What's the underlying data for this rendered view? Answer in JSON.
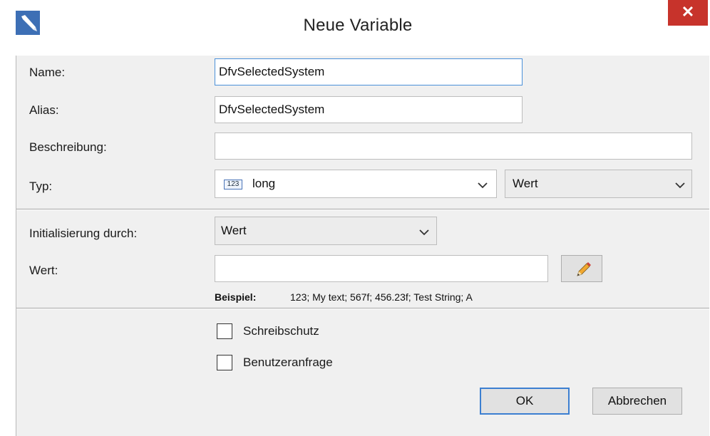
{
  "window": {
    "title": "Neue Variable",
    "close_glyph": "✕"
  },
  "form": {
    "name_label": "Name:",
    "name_value": "DfvSelectedSystem",
    "alias_label": "Alias:",
    "alias_value": "DfvSelectedSystem",
    "description_label": "Beschreibung:",
    "description_value": "",
    "type_label": "Typ:",
    "type_icon_text": "123",
    "type_value": "long",
    "type_mode_value": "Wert"
  },
  "init": {
    "label": "Initialisierung durch:",
    "value": "Wert",
    "wert_label": "Wert:",
    "wert_value": "",
    "example_label": "Beispiel:",
    "example_text": "123; My text; 567f; 456.23f; Test String; A"
  },
  "options": {
    "readonly_label": "Schreibschutz",
    "readonly_checked": false,
    "userquery_label": "Benutzeranfrage",
    "userquery_checked": false
  },
  "buttons": {
    "ok": "OK",
    "cancel": "Abbrechen"
  },
  "colors": {
    "close_bg": "#c7332b",
    "focus_border": "#4a90d9",
    "default_button_border": "#3c7fd1",
    "dialog_bg": "#f0f0f0"
  },
  "icons": {
    "app": "app-pen-icon",
    "close": "close-icon",
    "type": "numeric-type-icon",
    "dropdown": "chevron-down-icon",
    "edit": "pencil-icon"
  }
}
